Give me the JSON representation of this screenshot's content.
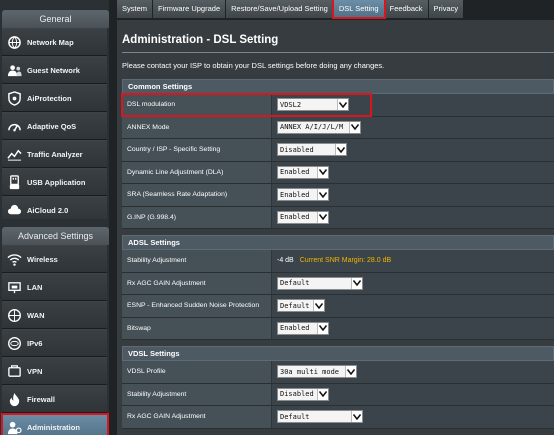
{
  "sidebar": {
    "general_title": "General",
    "advanced_title": "Advanced Settings",
    "general_items": [
      {
        "label": "Network Map",
        "icon": "network-map-icon"
      },
      {
        "label": "Guest Network",
        "icon": "guest-network-icon"
      },
      {
        "label": "AiProtection",
        "icon": "aiprotection-icon"
      },
      {
        "label": "Adaptive QoS",
        "icon": "adaptive-qos-icon"
      },
      {
        "label": "Traffic Analyzer",
        "icon": "traffic-analyzer-icon"
      },
      {
        "label": "USB Application",
        "icon": "usb-icon"
      },
      {
        "label": "AiCloud 2.0",
        "icon": "aicloud-icon"
      }
    ],
    "advanced_items": [
      {
        "label": "Wireless",
        "icon": "wireless-icon"
      },
      {
        "label": "LAN",
        "icon": "lan-icon"
      },
      {
        "label": "WAN",
        "icon": "wan-icon"
      },
      {
        "label": "IPv6",
        "icon": "ipv6-icon"
      },
      {
        "label": "VPN",
        "icon": "vpn-icon"
      },
      {
        "label": "Firewall",
        "icon": "firewall-icon"
      },
      {
        "label": "Administration",
        "icon": "administration-icon"
      }
    ]
  },
  "tabs": [
    "System",
    "Firmware Upgrade",
    "Restore/Save/Upload Setting",
    "DSL Setting",
    "Feedback",
    "Privacy"
  ],
  "active_tab": "DSL Setting",
  "page": {
    "title": "Administration - DSL Setting",
    "description": "Please contact your ISP to obtain your DSL settings before doing any changes."
  },
  "common": {
    "heading": "Common Settings",
    "dsl_modulation": {
      "label": "DSL modulation",
      "value": "VDSL2"
    },
    "annex_mode": {
      "label": "ANNEX Mode",
      "value": "ANNEX A/I/J/L/M"
    },
    "country_isp": {
      "label": "Country / ISP - Specific Setting",
      "value": "Disabled"
    },
    "dla": {
      "label": "Dynamic Line Adjustment (DLA)",
      "value": "Enabled"
    },
    "sra": {
      "label": "SRA (Seamless Rate Adaptation)",
      "value": "Enabled"
    },
    "ginp": {
      "label": "G.INP (G.998.4)",
      "value": "Enabled"
    }
  },
  "adsl": {
    "heading": "ADSL Settings",
    "stability": {
      "label": "Stability Adjustment",
      "value": "-4 dB",
      "snr": "Current SNR Margin: 28.0 dB"
    },
    "rx_agc": {
      "label": "Rx AGC GAIN Adjustment",
      "value": "Default"
    },
    "esnp": {
      "label": "ESNP - Enhanced Sudden Noise Protection",
      "value": "Default"
    },
    "bitswap": {
      "label": "Bitswap",
      "value": "Enabled"
    }
  },
  "vdsl": {
    "heading": "VDSL Settings",
    "profile": {
      "label": "VDSL Profile",
      "value": "30a multi mode"
    },
    "stability": {
      "label": "Stability Adjustment",
      "value": "Disabled"
    },
    "rx_agc": {
      "label": "Rx AGC GAIN Adjustment",
      "value": "Default"
    }
  },
  "colors": {
    "highlight": "#d8161e",
    "active_item": "#5e7f96",
    "snr_text": "#f4b400"
  }
}
